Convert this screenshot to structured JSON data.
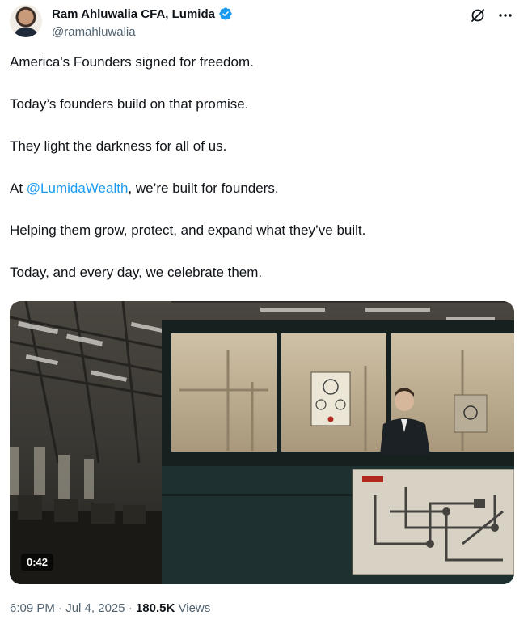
{
  "author": {
    "display_name": "Ram Ahluwalia CFA, Lumida",
    "handle": "@ramahluwalia",
    "verified": true,
    "verified_color": "#1d9bf0"
  },
  "top_icons": [
    "grok-icon",
    "more-icon"
  ],
  "tweet": {
    "lines": [
      "America's Founders signed for freedom.",
      "Today’s founders build on that promise.",
      "They light the darkness for all of us.",
      {
        "before": "At ",
        "mention": "@LumidaWealth",
        "after": ", we’re built for founders."
      },
      "Helping them grow, protect, and expand what they’ve built.",
      "Today, and every day, we celebrate them."
    ]
  },
  "video": {
    "duration": "0:42"
  },
  "meta": {
    "time": "6:09 PM",
    "separator": "·",
    "date": "Jul 4, 2025",
    "views_count": "180.5K",
    "views_label": "Views"
  },
  "colors": {
    "text": "#0f1419",
    "secondary": "#536471",
    "link": "#1d9bf0"
  }
}
